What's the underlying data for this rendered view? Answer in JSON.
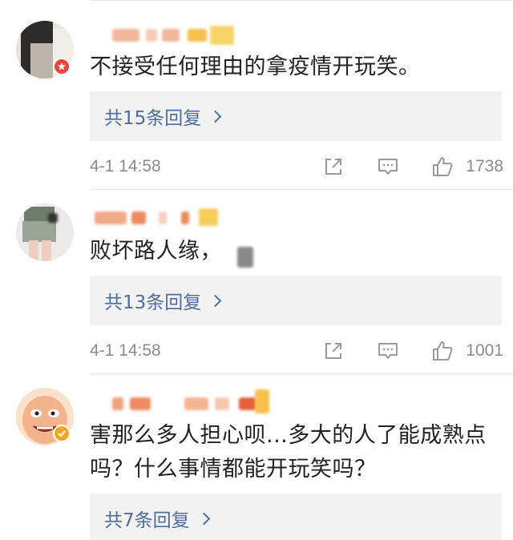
{
  "comments": [
    {
      "text": "不接受任何理由的拿疫情开玩笑。",
      "replies": "共15条回复",
      "time": "4-1 14:58",
      "likes": "1738"
    },
    {
      "text": "败坏路人缘，",
      "replies": "共13条回复",
      "time": "4-1 14:58",
      "likes": "1001"
    },
    {
      "text_line1": "害那么多人担心呗...多大的人了能成熟点",
      "text_line2": "吗？什么事情都能开玩笑吗？",
      "replies": "共7条回复"
    }
  ],
  "icons": {
    "share": "share-icon",
    "comment": "comment-icon",
    "like": "thumbs-up-icon",
    "reply_arrow": "chevron-right-icon",
    "badge_red": "weibo-badge-icon",
    "badge_gold": "verified-badge-icon"
  },
  "colors": {
    "reply_link": "#4f6d9c",
    "meta_gray": "#8b8b8b",
    "reply_bg": "#f2f2f2",
    "badge_red": "#e8453c",
    "badge_gold": "#f5a623"
  }
}
